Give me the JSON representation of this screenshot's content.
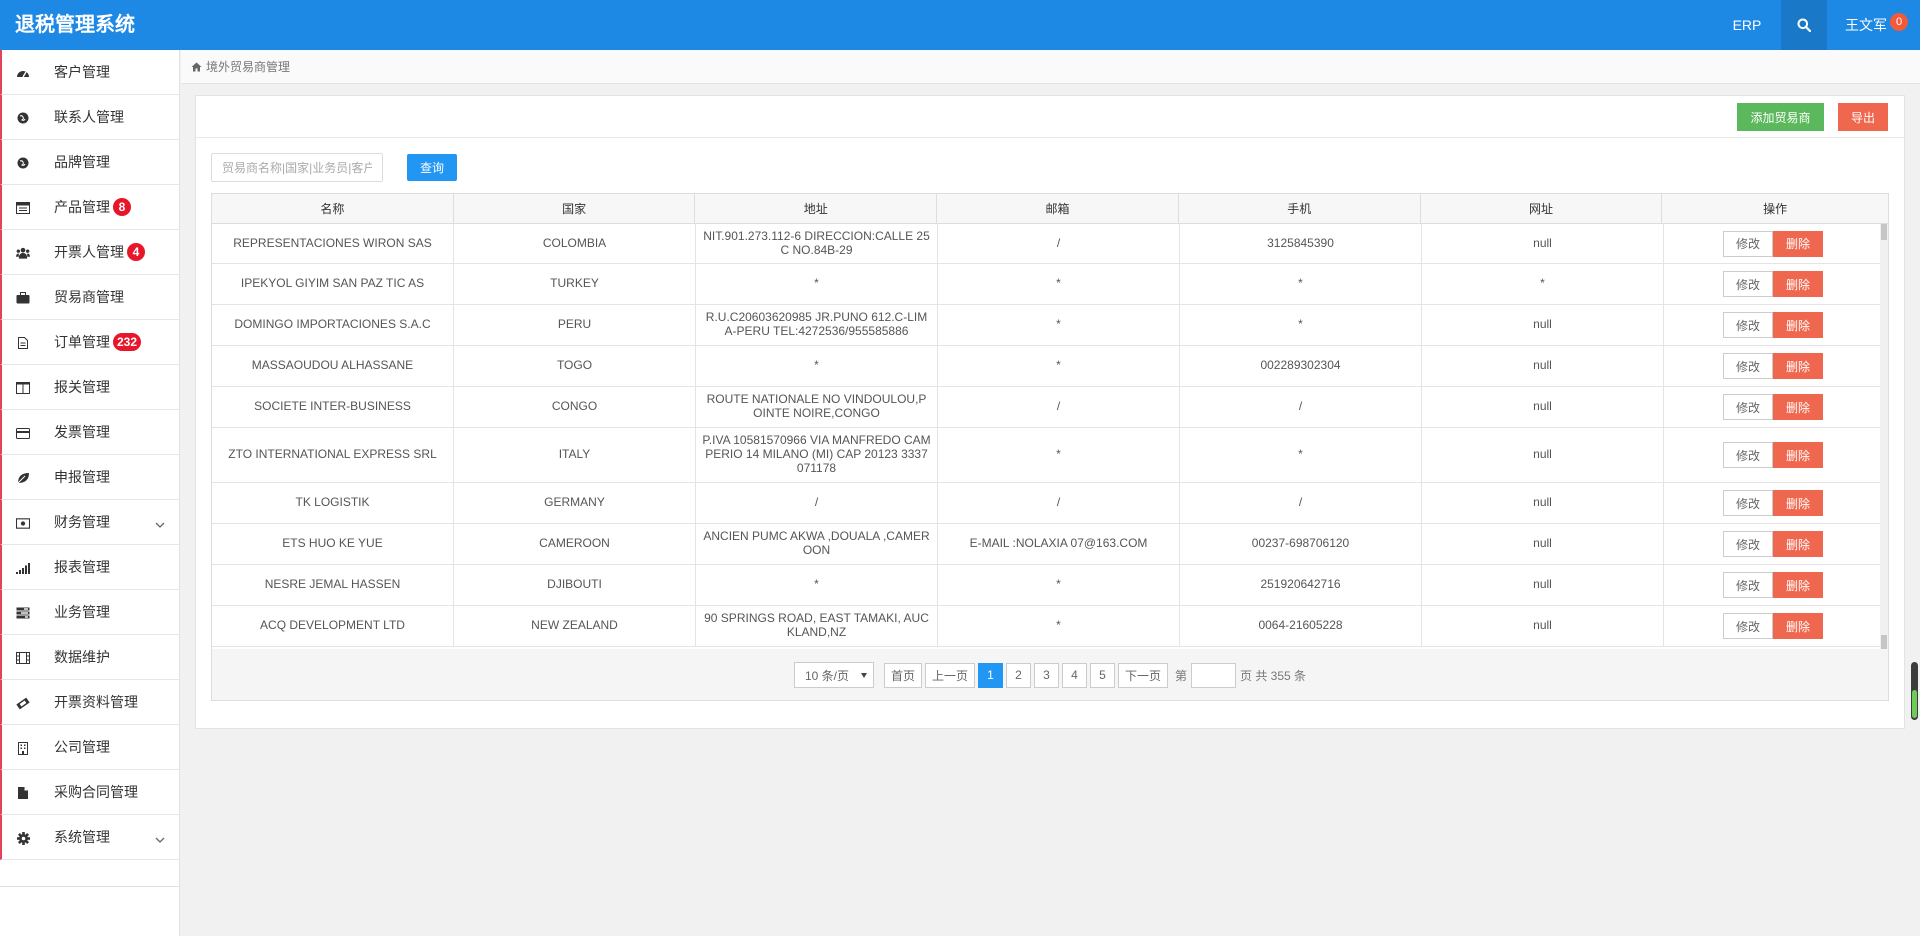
{
  "app": {
    "title": "退税管理系统",
    "erp_label": "ERP",
    "user_name": "王文军",
    "user_badge": "0"
  },
  "sidebar": {
    "items": [
      {
        "label": "客户管理",
        "icon": "dashboard-icon"
      },
      {
        "label": "联系人管理",
        "icon": "globe-icon"
      },
      {
        "label": "品牌管理",
        "icon": "globe-icon"
      },
      {
        "label": "产品管理",
        "icon": "list-icon",
        "badge": "8"
      },
      {
        "label": "开票人管理",
        "icon": "users-icon",
        "badge": "4"
      },
      {
        "label": "贸易商管理",
        "icon": "briefcase-icon"
      },
      {
        "label": "订单管理",
        "icon": "file-icon",
        "badge": "232"
      },
      {
        "label": "报关管理",
        "icon": "columns-icon"
      },
      {
        "label": "发票管理",
        "icon": "credit-card-icon"
      },
      {
        "label": "申报管理",
        "icon": "leaf-icon"
      },
      {
        "label": "财务管理",
        "icon": "money-icon",
        "has_children": true
      },
      {
        "label": "报表管理",
        "icon": "signal-icon"
      },
      {
        "label": "业务管理",
        "icon": "tasks-icon"
      },
      {
        "label": "数据维护",
        "icon": "film-icon"
      },
      {
        "label": "开票资料管理",
        "icon": "ticket-icon"
      },
      {
        "label": "公司管理",
        "icon": "building-icon"
      },
      {
        "label": "采购合同管理",
        "icon": "document-icon"
      },
      {
        "label": "系统管理",
        "icon": "gear-icon",
        "has_children": true
      }
    ]
  },
  "breadcrumb": {
    "icon": "home-icon",
    "label": "境外贸易商管理"
  },
  "toolbar": {
    "add_label": "添加贸易商",
    "export_label": "导出",
    "search_placeholder": "贸易商名称|国家|业务员|客户",
    "query_label": "查询"
  },
  "table": {
    "columns": [
      "名称",
      "国家",
      "地址",
      "邮箱",
      "手机",
      "网址",
      "操作"
    ],
    "edit_label": "修改",
    "delete_label": "删除",
    "rows": [
      {
        "name": "REPRESENTACIONES WIRON SAS",
        "country": "COLOMBIA",
        "address": "NIT.901.273.112-6 DIRECCION:CALLE 25C NO.84B-29",
        "email": "/",
        "phone": "3125845390",
        "website": "null"
      },
      {
        "name": "IPEKYOL GIYIM SAN PAZ TIC AS",
        "country": "TURKEY",
        "address": "*",
        "email": "*",
        "phone": "*",
        "website": "*"
      },
      {
        "name": "DOMINGO IMPORTACIONES S.A.C",
        "country": "PERU",
        "address": "R.U.C20603620985 JR.PUNO 612.C-LIMA-PERU TEL:4272536/955585886",
        "email": "*",
        "phone": "*",
        "website": "null"
      },
      {
        "name": "MASSAOUDOU ALHASSANE",
        "country": "TOGO",
        "address": "*",
        "email": "*",
        "phone": "002289302304",
        "website": "null"
      },
      {
        "name": "SOCIETE INTER-BUSINESS",
        "country": "CONGO",
        "address": "ROUTE NATIONALE NO VINDOULOU,POINTE NOIRE,CONGO",
        "email": "/",
        "phone": "/",
        "website": "null"
      },
      {
        "name": "ZTO INTERNATIONAL EXPRESS SRL",
        "country": "ITALY",
        "address": "P.IVA 10581570966 VIA MANFREDO CAMPERIO 14 MILANO (MI) CAP 20123 3337071178",
        "email": "*",
        "phone": "*",
        "website": "null"
      },
      {
        "name": "TK LOGISTIK",
        "country": "GERMANY",
        "address": "/",
        "email": "/",
        "phone": "/",
        "website": "null"
      },
      {
        "name": "ETS HUO KE YUE",
        "country": "CAMEROON",
        "address": "ANCIEN PUMC AKWA ,DOUALA ,CAMEROON",
        "email": "E-MAIL :NOLAXIA 07@163.COM",
        "phone": "00237-698706120",
        "website": "null"
      },
      {
        "name": "NESRE JEMAL HASSEN",
        "country": "DJIBOUTI",
        "address": "*",
        "email": "*",
        "phone": "251920642716",
        "website": "null"
      },
      {
        "name": "ACQ DEVELOPMENT LTD",
        "country": "NEW ZEALAND",
        "address": "90 SPRINGS ROAD, EAST TAMAKI, AUCKLAND,NZ",
        "email": "*",
        "phone": "0064-21605228",
        "website": "null"
      }
    ]
  },
  "pagination": {
    "page_size": "10 条/页",
    "first": "首页",
    "prev": "上一页",
    "pages": [
      "1",
      "2",
      "3",
      "4",
      "5"
    ],
    "current": "1",
    "next": "下一页",
    "jump_prefix": "第",
    "jump_suffix": "页 共 355 条"
  },
  "colors": {
    "topbar": "#1e88e5",
    "primary": "#2196f3",
    "success": "#5cb85c",
    "danger": "#f0674f",
    "badge": "#e8162b"
  }
}
